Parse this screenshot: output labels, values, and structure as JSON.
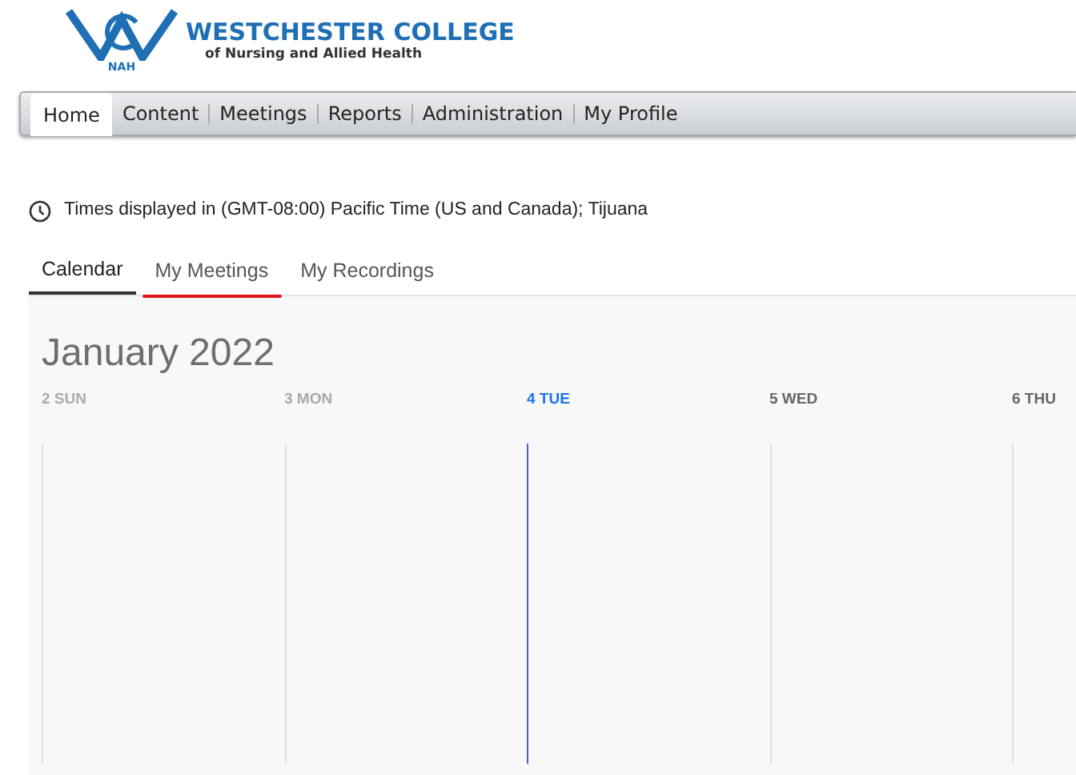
{
  "logo": {
    "monogram_sub": "NAH",
    "name": "WESTCHESTER COLLEGE",
    "tagline": "of Nursing and Allied Health"
  },
  "nav": [
    {
      "label": "Home",
      "selected": true
    },
    {
      "label": "Content",
      "selected": false
    },
    {
      "label": "Meetings",
      "selected": false
    },
    {
      "label": "Reports",
      "selected": false
    },
    {
      "label": "Administration",
      "selected": false
    },
    {
      "label": "My Profile",
      "selected": false
    }
  ],
  "timezone": "Times displayed in (GMT-08:00) Pacific Time (US and Canada); Tijuana",
  "tabs": [
    {
      "label": "Calendar",
      "selected": true,
      "annotated": false
    },
    {
      "label": "My Meetings",
      "selected": false,
      "annotated": true
    },
    {
      "label": "My Recordings",
      "selected": false,
      "annotated": false
    }
  ],
  "calendar": {
    "title": "January 2022",
    "days": [
      {
        "label": "2 SUN",
        "kind": "past"
      },
      {
        "label": "3 MON",
        "kind": "past"
      },
      {
        "label": "4 TUE",
        "kind": "today"
      },
      {
        "label": "5 WED",
        "kind": "future"
      },
      {
        "label": "6 THU",
        "kind": "future"
      }
    ]
  }
}
